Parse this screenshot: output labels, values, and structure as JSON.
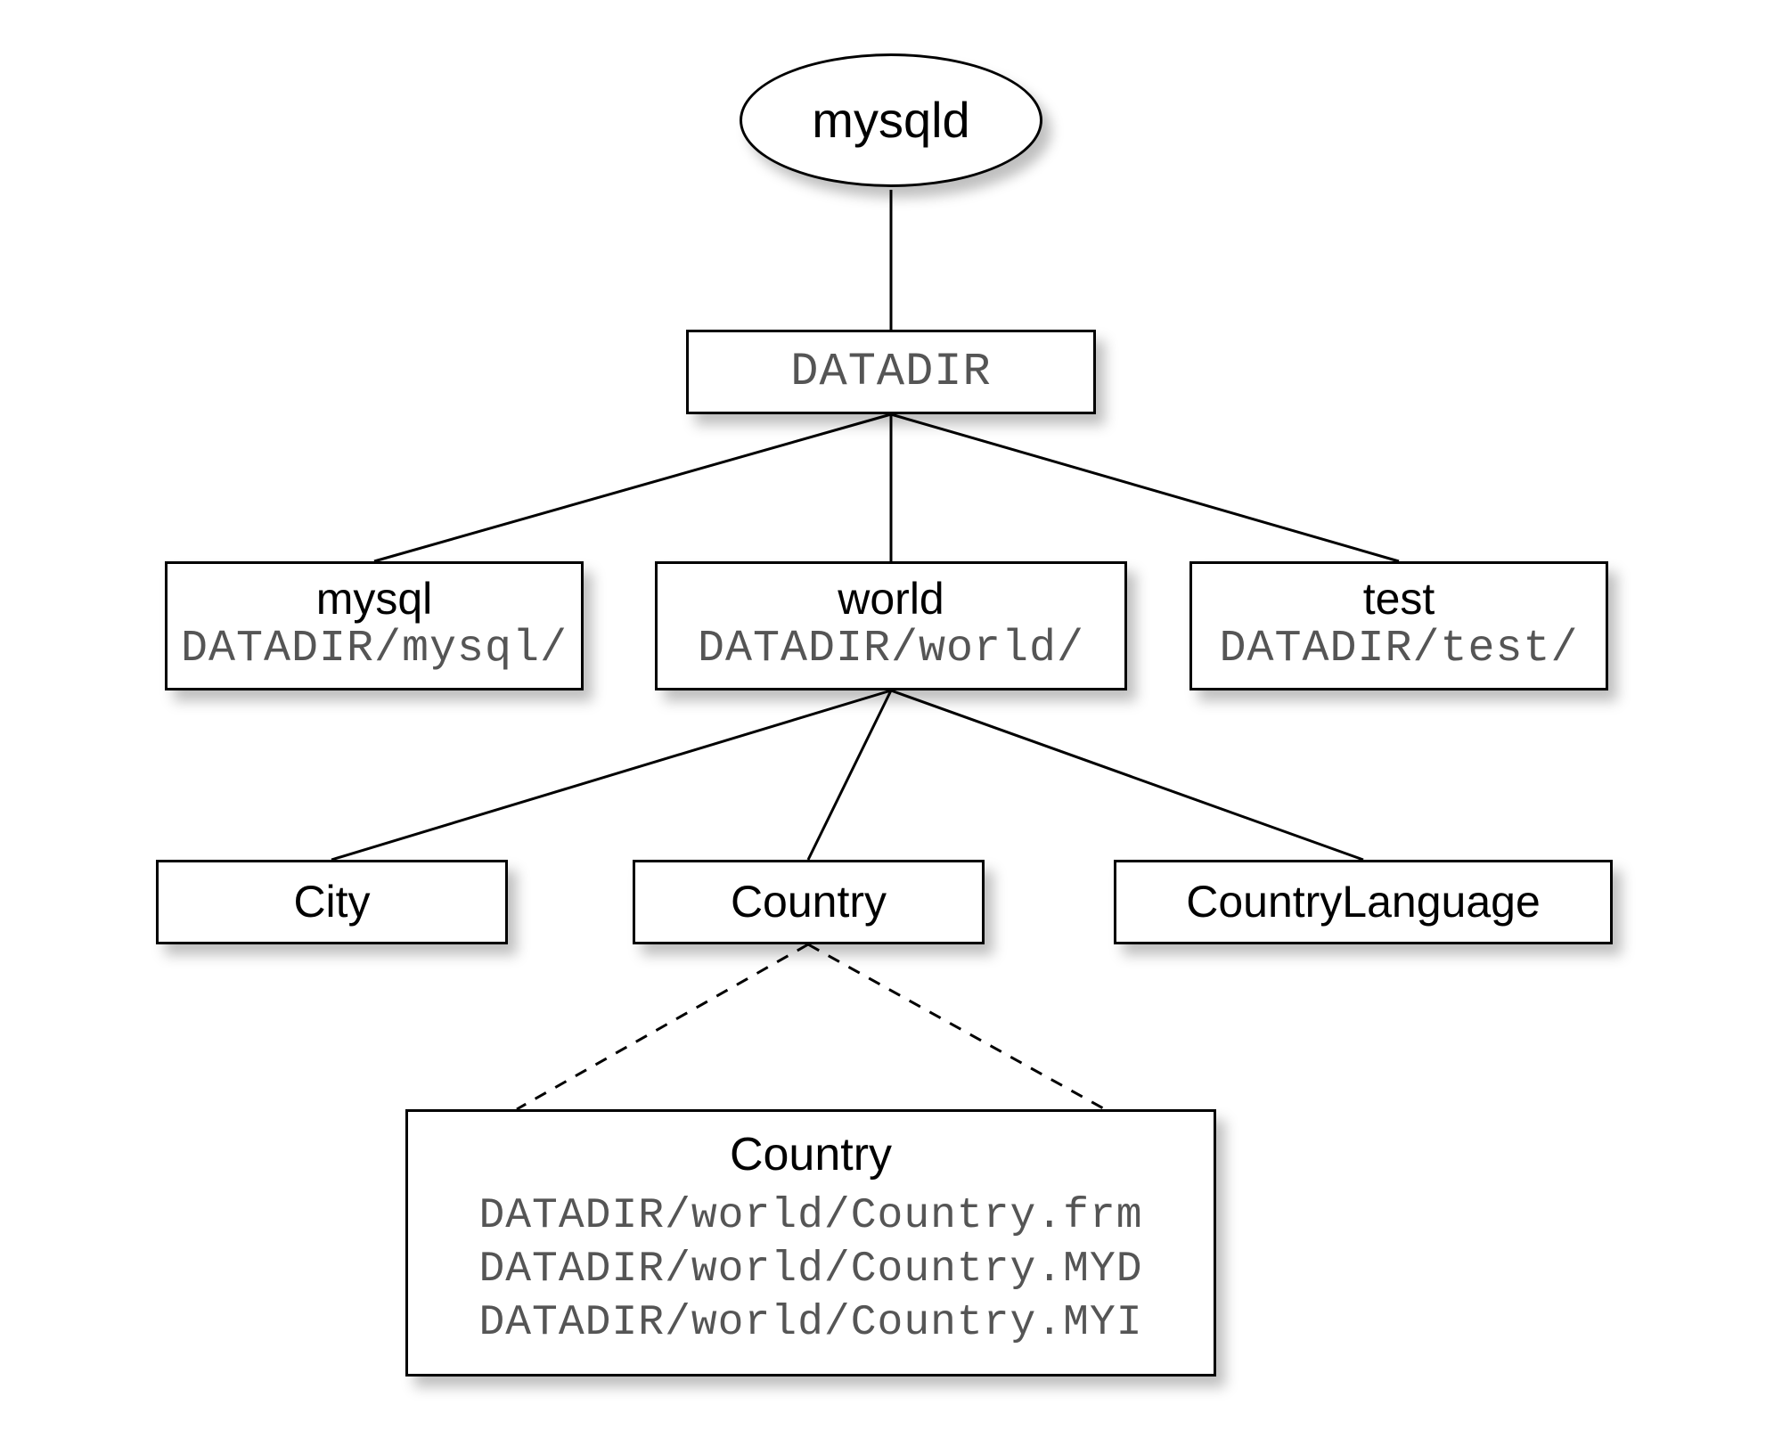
{
  "root": {
    "label": "mysqld"
  },
  "datadir": {
    "label": "DATADIR"
  },
  "databases": {
    "mysql": {
      "name": "mysql",
      "path": "DATADIR/mysql/"
    },
    "world": {
      "name": "world",
      "path": "DATADIR/world/"
    },
    "test": {
      "name": "test",
      "path": "DATADIR/test/"
    }
  },
  "tables": {
    "city": {
      "name": "City"
    },
    "country": {
      "name": "Country"
    },
    "countrylanguage": {
      "name": "CountryLanguage"
    }
  },
  "country_files": {
    "title": "Country",
    "file1": "DATADIR/world/Country.frm",
    "file2": "DATADIR/world/Country.MYD",
    "file3": "DATADIR/world/Country.MYI"
  }
}
